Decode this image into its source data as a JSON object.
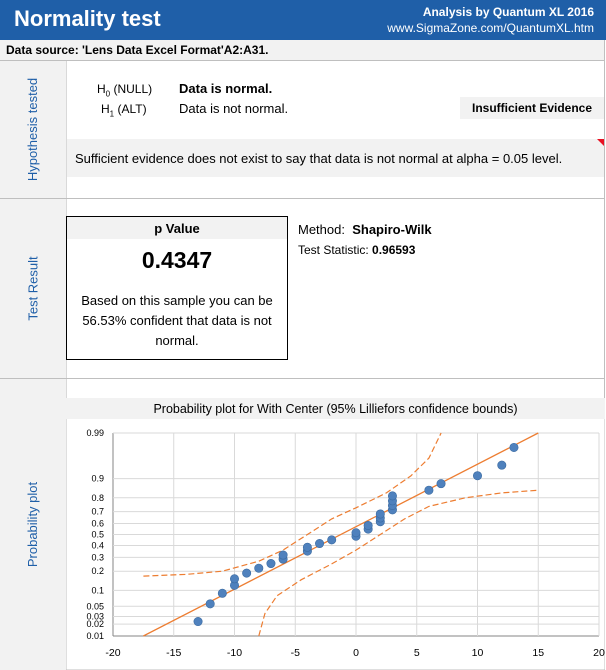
{
  "header": {
    "title": "Normality test",
    "brand": "Analysis by Quantum XL 2016",
    "url": "www.SigmaZone.com/QuantumXL.htm"
  },
  "data_source": "Data source:  'Lens Data Excel Format'A2:A31.",
  "sections": {
    "hypothesis": "Hypothesis tested",
    "result": "Test Result",
    "plot": "Probability plot"
  },
  "hypothesis": {
    "h0_label": "H",
    "h0_sub": "0",
    "h0_suffix": " (NULL)",
    "h0_text": "Data is normal.",
    "h1_label": "H",
    "h1_sub": "1",
    "h1_suffix": " (ALT)",
    "h1_text": "Data is not normal.",
    "evidence": "Insufficient Evidence",
    "conclusion": "Sufficient evidence does not exist to say that data is not normal at alpha = 0.05 level."
  },
  "result": {
    "pvalue_label": "p Value",
    "pvalue": "0.4347",
    "description": "Based on this sample you can be 56.53% confident that data is not normal.",
    "method_label": "Method:",
    "method": "Shapiro-Wilk",
    "stat_label": "Test Statistic:",
    "stat": "0.96593"
  },
  "colors": {
    "header": "#1f5fa8",
    "points": "#4f81bd",
    "fit_line": "#ed7d31"
  },
  "chart_data": {
    "type": "scatter",
    "title": "Probability plot for With Center (95% Lilliefors confidence bounds)",
    "xlim": [
      -20,
      20
    ],
    "x_ticks": [
      -20,
      -15,
      -10,
      -5,
      0,
      5,
      10,
      15,
      20
    ],
    "y_scale": "normal-probability",
    "y_ticks": [
      0.01,
      0.02,
      0.03,
      0.05,
      0.1,
      0.2,
      0.3,
      0.4,
      0.5,
      0.6,
      0.7,
      0.8,
      0.9,
      0.99
    ],
    "y_tick_labels": [
      "0.01",
      "0.02",
      "0.03",
      "0.05",
      "0.1",
      "0.2",
      "0.3",
      "0.4",
      "0.5",
      "0.6",
      "0.7",
      "0.8",
      "0.9",
      "0.99"
    ],
    "grid": true,
    "points": [
      {
        "x": -13,
        "y": 0.023
      },
      {
        "x": -12,
        "y": 0.056
      },
      {
        "x": -11,
        "y": 0.089
      },
      {
        "x": -10,
        "y": 0.122
      },
      {
        "x": -10,
        "y": 0.155
      },
      {
        "x": -9,
        "y": 0.188
      },
      {
        "x": -8,
        "y": 0.22
      },
      {
        "x": -7,
        "y": 0.253
      },
      {
        "x": -6,
        "y": 0.286
      },
      {
        "x": -6,
        "y": 0.319
      },
      {
        "x": -4,
        "y": 0.352
      },
      {
        "x": -4,
        "y": 0.385
      },
      {
        "x": -3,
        "y": 0.418
      },
      {
        "x": -2,
        "y": 0.451
      },
      {
        "x": 0,
        "y": 0.484
      },
      {
        "x": 0,
        "y": 0.516
      },
      {
        "x": 1,
        "y": 0.549
      },
      {
        "x": 1,
        "y": 0.582
      },
      {
        "x": 2,
        "y": 0.615
      },
      {
        "x": 2,
        "y": 0.648
      },
      {
        "x": 2,
        "y": 0.681
      },
      {
        "x": 3,
        "y": 0.714
      },
      {
        "x": 3,
        "y": 0.747
      },
      {
        "x": 3,
        "y": 0.78
      },
      {
        "x": 3,
        "y": 0.812
      },
      {
        "x": 6,
        "y": 0.845
      },
      {
        "x": 7,
        "y": 0.878
      },
      {
        "x": 10,
        "y": 0.911
      },
      {
        "x": 12,
        "y": 0.944
      },
      {
        "x": 13,
        "y": 0.977
      }
    ],
    "fit_line": {
      "x": [
        -17.5,
        15
      ],
      "y": [
        0.01,
        0.99
      ]
    },
    "lower_bound": [
      {
        "x": -8,
        "y": 0.01
      },
      {
        "x": -7.5,
        "y": 0.035
      },
      {
        "x": -6.5,
        "y": 0.08
      },
      {
        "x": -4.5,
        "y": 0.15
      },
      {
        "x": -2,
        "y": 0.25
      },
      {
        "x": 0,
        "y": 0.36
      },
      {
        "x": 2,
        "y": 0.5
      },
      {
        "x": 4,
        "y": 0.64
      },
      {
        "x": 6,
        "y": 0.74
      },
      {
        "x": 9,
        "y": 0.8
      },
      {
        "x": 12,
        "y": 0.83
      },
      {
        "x": 15,
        "y": 0.845
      }
    ],
    "upper_bound": [
      {
        "x": -17.5,
        "y": 0.17
      },
      {
        "x": -14,
        "y": 0.18
      },
      {
        "x": -11,
        "y": 0.2
      },
      {
        "x": -8,
        "y": 0.27
      },
      {
        "x": -6,
        "y": 0.36
      },
      {
        "x": -4,
        "y": 0.5
      },
      {
        "x": -2,
        "y": 0.64
      },
      {
        "x": 0,
        "y": 0.73
      },
      {
        "x": 2.5,
        "y": 0.83
      },
      {
        "x": 4.5,
        "y": 0.91
      },
      {
        "x": 6,
        "y": 0.96
      },
      {
        "x": 7,
        "y": 0.99
      }
    ]
  }
}
